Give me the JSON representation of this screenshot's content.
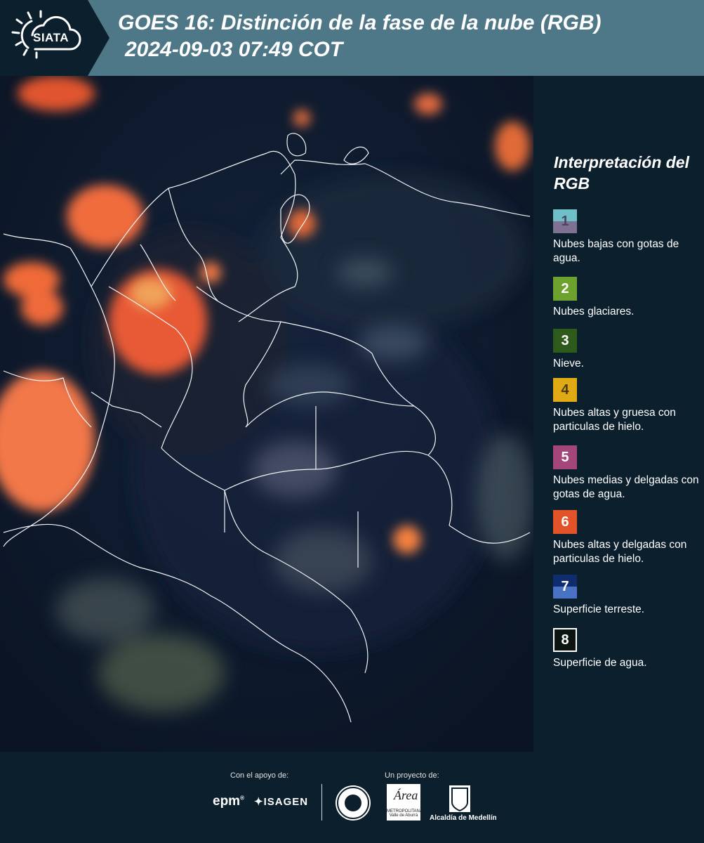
{
  "header": {
    "logo_label": "SIATA",
    "title_line1": "GOES 16: Distinción de la fase de la nube (RGB)",
    "title_line2": "2024-09-03 07:49 COT"
  },
  "legend": {
    "title": "Interpretación del RGB",
    "items": [
      {
        "number": "1",
        "label": "Nubes bajas con gotas de agua.",
        "color_top": "#6fbfc9",
        "color_bottom": "#7e7191"
      },
      {
        "number": "2",
        "label": "Nubes glaciares.",
        "color": "#6ea22f"
      },
      {
        "number": "3",
        "label": "Nieve.",
        "color": "#2e5b1c"
      },
      {
        "number": "4",
        "label": "Nubes altas y gruesa con particulas de hielo.",
        "color": "#e0aa14"
      },
      {
        "number": "5",
        "label": "Nubes medias y delgadas con gotas de agua.",
        "color": "#a5467a"
      },
      {
        "number": "6",
        "label": "Nubes altas y delgadas con particulas de hielo.",
        "color": "#e3532a"
      },
      {
        "number": "7",
        "label": "Superficie terreste.",
        "color_top": "#0f2d6e",
        "color_bottom": "#4a72c4"
      },
      {
        "number": "8",
        "label": "Superficie de agua.",
        "color": "#0b1410",
        "border": "#ffffff"
      }
    ]
  },
  "footer": {
    "support_label": "Con el apoyo de:",
    "project_label": "Un proyecto de:",
    "sponsor_epm": "epm",
    "sponsor_isagen": "ISAGEN",
    "area_label": "METROPOLITANA Valle de Aburrá",
    "alcaldia_label": "Alcaldía de Medellín"
  },
  "colors": {
    "header_bg": "#4e7888",
    "page_bg": "#0c1f2c",
    "cloud_orange": "#f26a35"
  }
}
